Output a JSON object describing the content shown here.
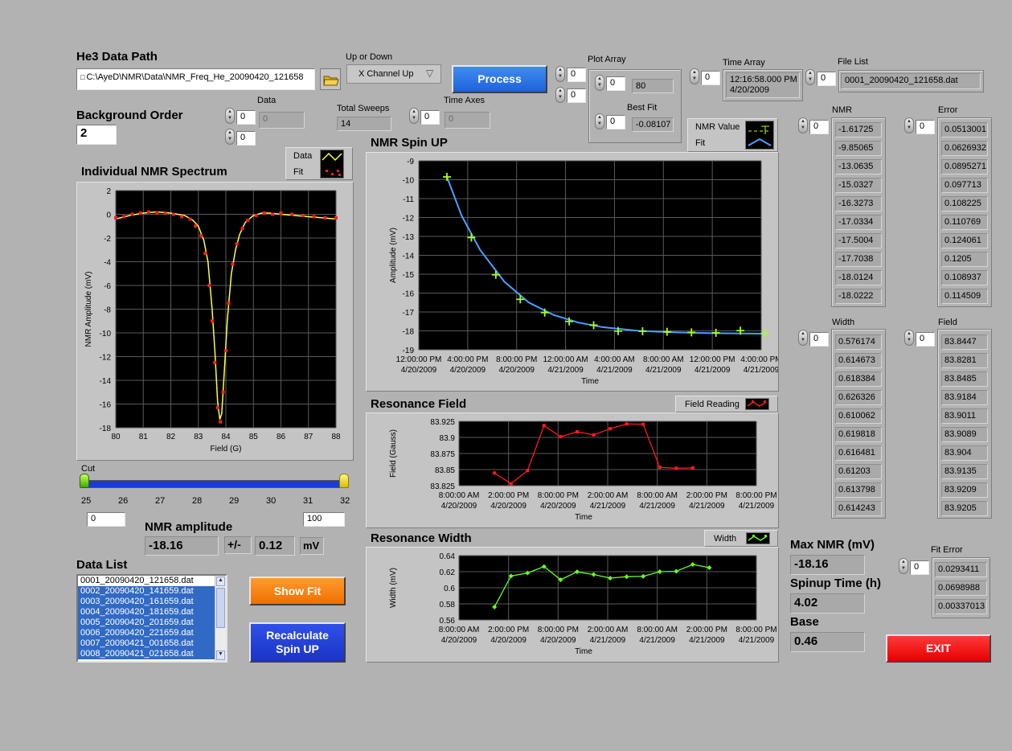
{
  "data_path": {
    "label": "He3 Data Path",
    "value": "C:\\AyeD\\NMR\\Data\\NMR_Freq_He_20090420_121658"
  },
  "up_down": {
    "label": "Up or Down",
    "value": "X Channel Up"
  },
  "process_label": "Process",
  "plot_array": {
    "label": "Plot Array",
    "idx_a": "0",
    "idx_b": "0",
    "idx_c": "0",
    "value": "80",
    "best_fit_label": "Best Fit",
    "best_fit_idx": "0",
    "best_fit_value": "-0.08107"
  },
  "time_array": {
    "label": "Time Array",
    "idx": "0",
    "value_line1": "12:16:58.000 PM",
    "value_line2": "4/20/2009"
  },
  "file_list": {
    "label": "File List",
    "idx": "0",
    "value": "0001_20090420_121658.dat"
  },
  "background_order": {
    "label": "Background Order",
    "value": "2"
  },
  "data_field": {
    "label": "Data",
    "idx1": "0",
    "idx2": "0",
    "value": "0"
  },
  "total_sweeps": {
    "label": "Total Sweeps",
    "value": "14"
  },
  "time_axes": {
    "label": "Time Axes",
    "idx": "0",
    "value": "0"
  },
  "nmr_col": {
    "label": "NMR",
    "idx": "0",
    "values": [
      "-1.61725",
      "-9.85065",
      "-13.0635",
      "-15.0327",
      "-16.3273",
      "-17.0334",
      "-17.5004",
      "-17.7038",
      "-18.0124",
      "-18.0222"
    ]
  },
  "error_col": {
    "label": "Error",
    "idx": "0",
    "values": [
      "0.0513001",
      "0.0626932",
      "0.0895271",
      "0.097713",
      "0.108225",
      "0.110769",
      "0.124061",
      "0.1205",
      "0.108937",
      "0.114509"
    ]
  },
  "width_col": {
    "label": "Width",
    "idx": "0",
    "values": [
      "0.576174",
      "0.614673",
      "0.618384",
      "0.626326",
      "0.610062",
      "0.619818",
      "0.616481",
      "0.61203",
      "0.613798",
      "0.614243"
    ]
  },
  "field_col": {
    "label": "Field",
    "idx": "0",
    "values": [
      "83.8447",
      "83.8281",
      "83.8485",
      "83.9184",
      "83.9011",
      "83.9089",
      "83.904",
      "83.9135",
      "83.9209",
      "83.9205"
    ]
  },
  "spectrum_legend": {
    "data": "Data",
    "fit": "Fit"
  },
  "spinup_legend": {
    "data": "NMR Value",
    "fit": "Fit"
  },
  "field_legend": {
    "label": "Field Reading"
  },
  "width_legend": {
    "label": "Width"
  },
  "cut": {
    "label": "Cut",
    "ticks": [
      "25",
      "26",
      "27",
      "28",
      "29",
      "30",
      "31",
      "32"
    ],
    "low": "0",
    "high": "100"
  },
  "nmr_amplitude": {
    "label": "NMR amplitude",
    "value": "-18.16",
    "pm": "+/-",
    "err": "0.12",
    "unit": "mV"
  },
  "data_list": {
    "label": "Data List",
    "items": [
      "0001_20090420_121658.dat",
      "0002_20090420_141659.dat",
      "0003_20090420_161659.dat",
      "0004_20090420_181659.dat",
      "0005_20090420_201659.dat",
      "0006_20090420_221659.dat",
      "0007_20090421_001658.dat",
      "0008_20090421_021658.dat"
    ]
  },
  "show_fit_label": "Show Fit",
  "recalc_label_1": "Recalculate",
  "recalc_label_2": "Spin UP",
  "max_nmr": {
    "label": "Max NMR (mV)",
    "value": "-18.16"
  },
  "spinup_time": {
    "label": "Spinup Time (h)",
    "value": "4.02"
  },
  "base": {
    "label": "Base",
    "value": "0.46"
  },
  "fit_error": {
    "label": "Fit Error",
    "idx": "0",
    "values": [
      "0.0293411",
      "0.0698988",
      "0.00337013"
    ]
  },
  "exit_label": "EXIT",
  "colors": {
    "panel": "#c4c4c4",
    "background": "#b2b2b2",
    "plot_bg": "#000000",
    "process": "#1e6ee6",
    "show_fit": "#ff7f0e",
    "recalc": "#1e3fd0",
    "exit": "#ff1a1a",
    "spectrum_data": "#ff2020",
    "spectrum_fit": "#ffff40",
    "spinup_data": "#a8ff20",
    "spinup_fit": "#4aa0ff",
    "field": "#ff1a1a",
    "width": "#66ff22"
  },
  "chart_data": [
    {
      "type": "scatter",
      "title": "Individual NMR Spectrum",
      "xlabel": "Field (G)",
      "ylabel": "NMR Amplitude (mV)",
      "xlim": [
        80,
        88
      ],
      "ylim": [
        -18,
        2
      ],
      "xticks": [
        80,
        81,
        82,
        83,
        84,
        85,
        86,
        87,
        88
      ],
      "yticks": [
        2,
        0,
        -2,
        -4,
        -6,
        -8,
        -10,
        -12,
        -14,
        -16,
        -18
      ],
      "series": [
        {
          "name": "Data",
          "x": [
            80.0,
            80.3,
            80.6,
            80.9,
            81.2,
            81.5,
            81.8,
            82.1,
            82.4,
            82.7,
            82.9,
            83.1,
            83.25,
            83.4,
            83.5,
            83.6,
            83.7,
            83.8,
            83.9,
            84.0,
            84.1,
            84.25,
            84.4,
            84.6,
            84.8,
            85.1,
            85.4,
            85.7,
            86.0,
            86.4,
            86.8,
            87.2,
            87.6,
            88.0
          ],
          "y": [
            -0.3,
            -0.2,
            0.0,
            0.1,
            0.2,
            0.1,
            0.1,
            0.0,
            -0.2,
            -0.4,
            -1.0,
            -1.8,
            -3.3,
            -6.0,
            -9.0,
            -12.5,
            -16.3,
            -17.5,
            -15.0,
            -11.5,
            -7.5,
            -4.2,
            -2.5,
            -1.2,
            -0.5,
            -0.1,
            0.1,
            0.0,
            0.1,
            0.0,
            -0.1,
            -0.2,
            -0.3,
            -0.3
          ]
        },
        {
          "name": "Fit",
          "x": [
            80.0,
            80.5,
            81.0,
            81.5,
            82.0,
            82.5,
            82.8,
            83.0,
            83.2,
            83.35,
            83.5,
            83.6,
            83.7,
            83.78,
            83.85,
            83.95,
            84.05,
            84.2,
            84.35,
            84.5,
            84.7,
            85.0,
            85.3,
            85.6,
            86.0,
            86.5,
            87.0,
            87.5,
            88.0
          ],
          "y": [
            -0.4,
            -0.1,
            0.1,
            0.2,
            0.1,
            -0.1,
            -0.5,
            -1.0,
            -2.2,
            -4.0,
            -8.0,
            -11.5,
            -15.8,
            -17.3,
            -16.8,
            -13.0,
            -9.0,
            -5.0,
            -3.0,
            -1.7,
            -0.7,
            -0.1,
            0.1,
            0.1,
            0.0,
            -0.1,
            -0.2,
            -0.3,
            -0.4
          ]
        }
      ]
    },
    {
      "type": "line",
      "title": "NMR Spin UP",
      "xlabel": "Time",
      "ylabel": "Amplitude (mV)",
      "ylim": [
        -19,
        -9
      ],
      "xtick_labels": [
        [
          "12:00:00 PM",
          "4/20/2009"
        ],
        [
          "4:00:00 PM",
          "4/20/2009"
        ],
        [
          "8:00:00 PM",
          "4/20/2009"
        ],
        [
          "12:00:00 AM",
          "4/21/2009"
        ],
        [
          "4:00:00 AM",
          "4/21/2009"
        ],
        [
          "8:00:00 AM",
          "4/21/2009"
        ],
        [
          "12:00:00 PM",
          "4/21/2009"
        ],
        [
          "4:00:00 PM",
          "4/21/2009"
        ]
      ],
      "yticks": [
        -9,
        -10,
        -11,
        -12,
        -13,
        -14,
        -15,
        -16,
        -17,
        -18,
        -19
      ],
      "series": [
        {
          "name": "NMR Value",
          "x_hours": [
            2.3,
            4.3,
            6.3,
            8.3,
            10.3,
            12.3,
            14.3,
            16.3,
            18.3,
            20.3,
            22.3,
            24.3,
            26.3,
            28.3
          ],
          "values": [
            -9.85,
            -13.06,
            -15.03,
            -16.33,
            -17.03,
            -17.5,
            -17.7,
            -18.01,
            -18.02,
            -18.05,
            -18.08,
            -18.1,
            -17.99,
            -18.14
          ]
        },
        {
          "name": "Fit",
          "x_hours": [
            2.3,
            3.5,
            5,
            7,
            9,
            11,
            13,
            15,
            18,
            21,
            24,
            28.3
          ],
          "values": [
            -9.85,
            -11.9,
            -13.7,
            -15.4,
            -16.5,
            -17.15,
            -17.55,
            -17.8,
            -18.0,
            -18.08,
            -18.12,
            -18.15
          ]
        }
      ]
    },
    {
      "type": "line",
      "title": "Resonance Field",
      "xlabel": "Time",
      "ylabel": "Field (Gauss)",
      "ylim": [
        83.825,
        83.925
      ],
      "yticks": [
        83.925,
        83.9,
        83.875,
        83.85,
        83.825
      ],
      "xtick_labels": [
        [
          "8:00:00 AM",
          "4/20/2009"
        ],
        [
          "2:00:00 PM",
          "4/20/2009"
        ],
        [
          "8:00:00 PM",
          "4/20/2009"
        ],
        [
          "2:00:00 AM",
          "4/21/2009"
        ],
        [
          "8:00:00 AM",
          "4/21/2009"
        ],
        [
          "2:00:00 PM",
          "4/21/2009"
        ],
        [
          "8:00:00 PM",
          "4/21/2009"
        ]
      ],
      "series": [
        {
          "name": "Field Reading",
          "x_hours": [
            4.3,
            6.3,
            8.3,
            10.3,
            12.3,
            14.3,
            16.3,
            18.3,
            20.3,
            22.3,
            24.3,
            26.3,
            28.3
          ],
          "values": [
            83.8447,
            83.8281,
            83.8485,
            83.9184,
            83.9011,
            83.9089,
            83.904,
            83.9135,
            83.9209,
            83.9205,
            83.8535,
            83.852,
            83.8525
          ]
        }
      ]
    },
    {
      "type": "line",
      "title": "Resonance Width",
      "xlabel": "Time",
      "ylabel": "Width (mV)",
      "ylim": [
        0.56,
        0.64
      ],
      "yticks": [
        0.64,
        0.62,
        0.6,
        0.58,
        0.56
      ],
      "xtick_labels": [
        [
          "8:00:00 AM",
          "4/20/2009"
        ],
        [
          "2:00:00 PM",
          "4/20/2009"
        ],
        [
          "8:00:00 PM",
          "4/20/2009"
        ],
        [
          "2:00:00 AM",
          "4/21/2009"
        ],
        [
          "8:00:00 AM",
          "4/21/2009"
        ],
        [
          "2:00:00 PM",
          "4/21/2009"
        ],
        [
          "8:00:00 PM",
          "4/21/2009"
        ]
      ],
      "series": [
        {
          "name": "Width",
          "x_hours": [
            4.3,
            6.3,
            8.3,
            10.3,
            12.3,
            14.3,
            16.3,
            18.3,
            20.3,
            22.3,
            24.3,
            26.3,
            28.3,
            30.3
          ],
          "values": [
            0.576174,
            0.614673,
            0.618384,
            0.626326,
            0.610062,
            0.619818,
            0.616481,
            0.61203,
            0.613798,
            0.614243,
            0.62,
            0.6205,
            0.629,
            0.625
          ]
        }
      ]
    }
  ]
}
